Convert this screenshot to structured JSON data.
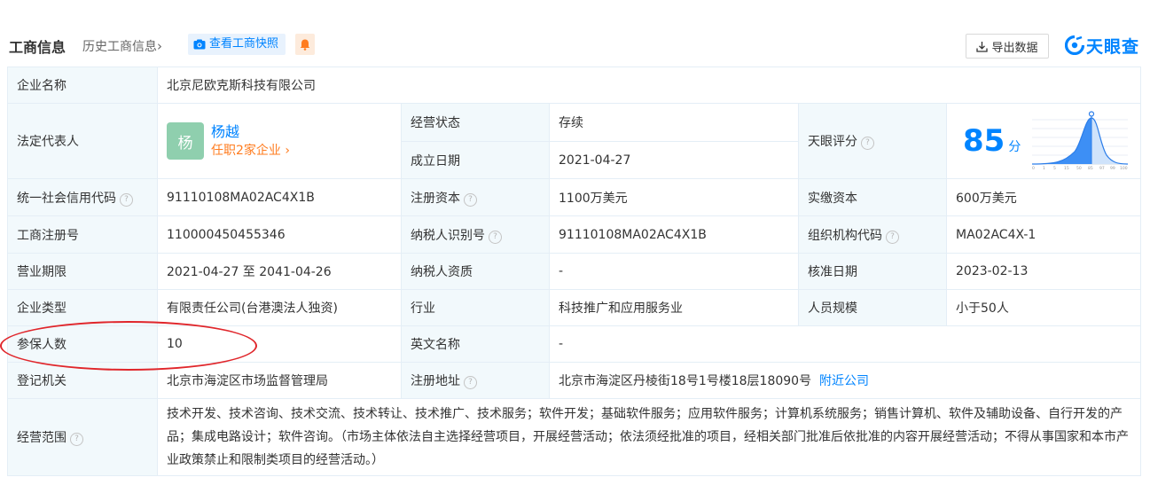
{
  "header": {
    "title": "工商信息",
    "history_link": "历史工商信息",
    "snapshot_button": "查看工商快照",
    "export_button": "导出数据",
    "logo_text": "天眼查"
  },
  "labels": {
    "company_name": "企业名称",
    "legal_rep": "法定代表人",
    "operating_status": "经营状态",
    "established_date": "成立日期",
    "tianyan_score": "天眼评分",
    "credit_code": "统一社会信用代码",
    "registered_capital": "注册资本",
    "paid_capital": "实缴资本",
    "reg_number": "工商注册号",
    "taxpayer_id": "纳税人识别号",
    "org_code": "组织机构代码",
    "business_term": "营业期限",
    "taxpayer_qualification": "纳税人资质",
    "approval_date": "核准日期",
    "company_type": "企业类型",
    "industry": "行业",
    "staff_size": "人员规模",
    "insured_count": "参保人数",
    "english_name": "英文名称",
    "registration_authority": "登记机关",
    "registered_address": "注册地址",
    "business_scope": "经营范围"
  },
  "values": {
    "company_name": "北京尼欧克斯科技有限公司",
    "legal_rep_avatar": "杨",
    "legal_rep_name": "杨越",
    "legal_rep_positions": "任职2家企业",
    "operating_status": "存续",
    "established_date": "2021-04-27",
    "score": "85",
    "score_unit": "分",
    "credit_code": "91110108MA02AC4X1B",
    "registered_capital": "1100万美元",
    "paid_capital": "600万美元",
    "reg_number": "110000450455346",
    "taxpayer_id": "91110108MA02AC4X1B",
    "org_code": "MA02AC4X-1",
    "business_term": "2021-04-27 至 2041-04-26",
    "taxpayer_qualification": "-",
    "approval_date": "2023-02-13",
    "company_type": "有限责任公司(台港澳法人独资)",
    "industry": "科技推广和应用服务业",
    "staff_size": "小于50人",
    "insured_count": "10",
    "english_name": "-",
    "registration_authority": "北京市海淀区市场监督管理局",
    "registered_address": "北京市海淀区丹棱街18号1号楼18层18090号",
    "nearby_link": "附近公司",
    "business_scope": "技术开发、技术咨询、技术交流、技术转让、技术推广、技术服务；软件开发；基础软件服务；应用软件服务；计算机系统服务；销售计算机、软件及辅助设备、自行开发的产品；集成电路设计；软件咨询。（市场主体依法自主选择经营项目，开展经营活动；依法须经批准的项目，经相关部门批准后依批准的内容开展经营活动；不得从事国家和本市产业政策禁止和限制类项目的经营活动。）"
  },
  "score_chart": {
    "tick_labels": [
      "0",
      "1",
      "5",
      "15",
      "50",
      "85",
      "97",
      "99",
      "100"
    ]
  },
  "colors": {
    "accent": "#0084ff",
    "label_bg": "#f2f9fc",
    "status_green": "#00a36c",
    "link_orange": "#ff7c1f",
    "annotation_red": "#e0262b"
  }
}
